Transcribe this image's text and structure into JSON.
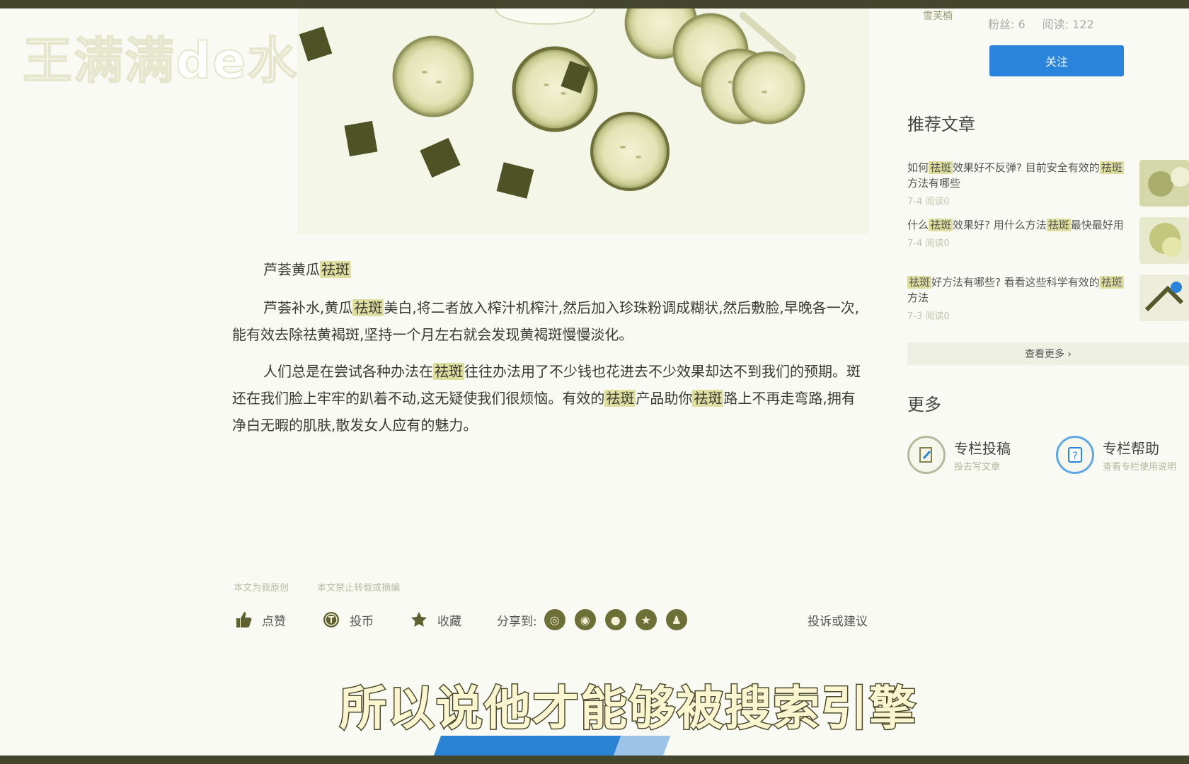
{
  "watermark": "王满满de水印",
  "article": {
    "subtitle_prefix": "芦荟黄瓜",
    "subtitle_keyword": "祛斑",
    "para1": {
      "a": "芦荟补水,黄瓜",
      "kw": "祛斑",
      "b": "美白,将二者放入榨汁机榨汁,然后加入珍珠粉调成糊状,然后敷脸,早晚各一次,能有效去除祛黄褐斑,坚持一个月左右就会发现黄褐斑慢慢淡化。"
    },
    "para2": {
      "a": "人们总是在尝试各种办法在",
      "kw1": "祛斑",
      "b": "往往办法用了不少钱也花进去不少效果却达不到我们的预期。斑还在我们脸上牢牢的趴着不动,这无疑使我们很烦恼。有效的",
      "kw2": "祛斑",
      "c": "产品助你",
      "kw3": "祛斑",
      "d": "路上不再走弯路,拥有净白无暇的肌肤,散发女人应有的魅力。"
    }
  },
  "meta": {
    "original": "本文为我原创",
    "no_reprint": "本文禁止转载或摘编"
  },
  "actions": {
    "like": "点赞",
    "coin": "投币",
    "favorite": "收藏",
    "share_label": "分享到:",
    "report": "投诉或建议"
  },
  "caption": "所以说他才能够被搜索引擎",
  "sidebar": {
    "logo": "雪芙楠",
    "fans": "粉丝: 6",
    "reads": "阅读: 122",
    "follow": "关注",
    "recommend_title": "推荐文章",
    "recommend": [
      {
        "title_a": "如何",
        "kw": "祛斑",
        "title_b": "效果好不反弹? 目前安全有效的",
        "kw2": "祛斑",
        "title_c": "方法有哪些",
        "meta": "7-4 阅读0"
      },
      {
        "title_a": "什么",
        "kw": "祛斑",
        "title_b": "效果好? 用什么方法",
        "kw2": "祛斑",
        "title_c": "最快最好用",
        "meta": "7-4 阅读0"
      },
      {
        "title_a": "",
        "kw": "祛斑",
        "title_b": "好方法有哪些? 看看这些科学有效的",
        "kw2": "祛斑",
        "title_c": "方法",
        "meta": "7-3 阅读0"
      }
    ],
    "see_more": "查看更多 ›",
    "more_title": "更多",
    "more": [
      {
        "title": "专栏投稿",
        "sub": "投去写文章"
      },
      {
        "title": "专栏帮助",
        "sub": "查看专栏使用说明"
      }
    ]
  },
  "colors": {
    "accent": "#2a84dc",
    "highlight": "#dede9f",
    "frame": "#43462c"
  }
}
